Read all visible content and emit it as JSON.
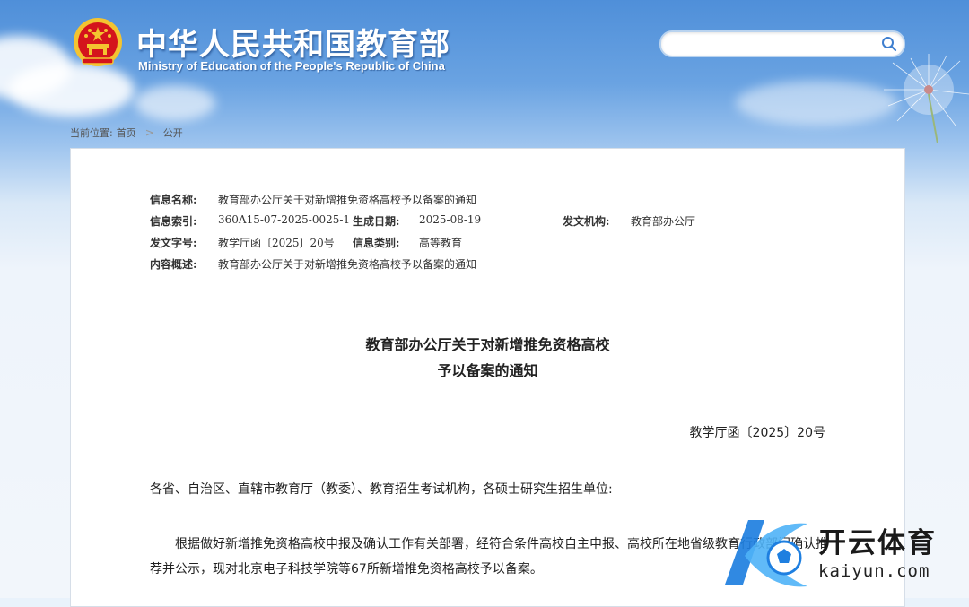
{
  "header": {
    "site_title": "中华人民共和国教育部",
    "site_subtitle": "Ministry of Education of the People's Republic of China",
    "search_placeholder": ""
  },
  "breadcrumb": {
    "prefix": "当前位置:",
    "items": [
      "首页",
      "公开"
    ],
    "separator": ">"
  },
  "meta": {
    "name_label": "信息名称:",
    "name_value": "教育部办公厅关于对新增推免资格高校予以备案的通知",
    "index_label": "信息索引:",
    "index_value": "360A15-07-2025-0025-1",
    "date_label": "生成日期:",
    "date_value": "2025-08-19",
    "agency_label": "发文机构:",
    "agency_value": "教育部办公厅",
    "docno_label": "发文字号:",
    "docno_value": "教学厅函〔2025〕20号",
    "category_label": "信息类别:",
    "category_value": "高等教育",
    "summary_label": "内容概述:",
    "summary_value": "教育部办公厅关于对新增推免资格高校予以备案的通知"
  },
  "document": {
    "title_line1": "教育部办公厅关于对新增推免资格高校",
    "title_line2": "予以备案的通知",
    "number": "教学厅函〔2025〕20号",
    "salutation": "各省、自治区、直辖市教育厅（教委）、教育招生考试机构，各硕士研究生招生单位:",
    "body": "根据做好新增推免资格高校申报及确认工作有关部署，经符合条件高校自主申报、高校所在地省级教育行政部门确认推荐并公示，现对北京电子科技学院等67所新增推免资格高校予以备案。"
  },
  "watermark": {
    "name": "开云体育",
    "domain": "kaiyun.com"
  },
  "colors": {
    "header_blue": "#4f8fd9",
    "emblem_red": "#d4141c",
    "emblem_gold": "#f4c430",
    "logo_blue": "#1e7fe0"
  }
}
